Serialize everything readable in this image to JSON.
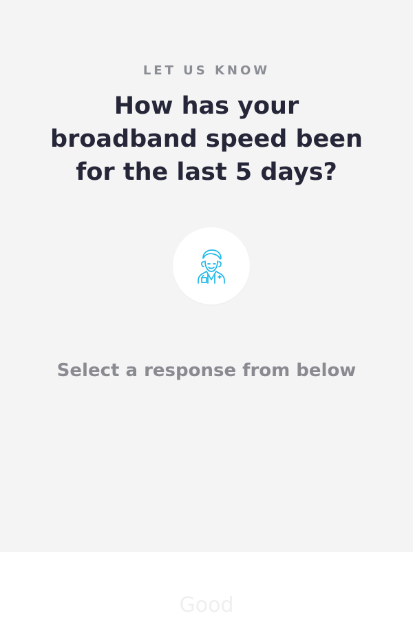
{
  "survey": {
    "eyebrow": "LET US KNOW",
    "question": "How has your broadband speed been for the last 5 days?",
    "instruction": "Select a response from below"
  },
  "avatar": {
    "icon": "support-agent-icon",
    "color": "#1cb8e8"
  },
  "responses": {
    "visible_option": "Good"
  },
  "colors": {
    "background": "#f4f4f4",
    "question_text": "#252638",
    "eyebrow_text": "#8b8d95",
    "instruction_text": "#8a8b91",
    "response_panel": "#ffffff",
    "response_text": "#efefef"
  }
}
